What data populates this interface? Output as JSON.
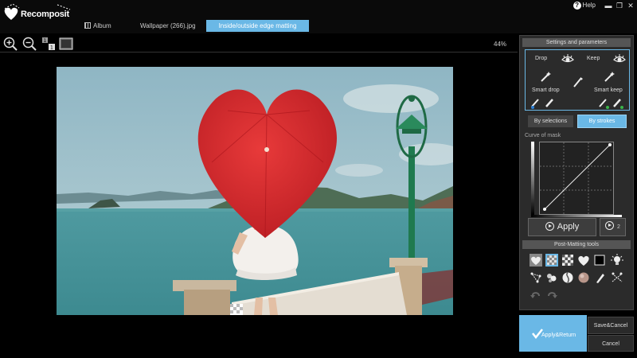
{
  "app": {
    "name": "Recomposit"
  },
  "header": {
    "help_label": "Help",
    "tabs": [
      {
        "label": "Album",
        "icon": "album-icon"
      },
      {
        "label": "Wallpaper (266).jpg"
      },
      {
        "label": "Inside/outside edge matting",
        "active": true
      }
    ]
  },
  "toolbar": {
    "zoom_percent": "44%",
    "tools": [
      "zoom-in-icon",
      "zoom-out-icon",
      "actual-size-icon",
      "fit-to-screen-icon"
    ]
  },
  "panel": {
    "title": "Settings and parameters",
    "drop_label": "Drop",
    "keep_label": "Keep",
    "smart_drop_label": "Smart drop",
    "smart_keep_label": "Smart keep",
    "mode_by_selections": "By selections",
    "mode_by_strokes": "By strokes",
    "active_mode": "By strokes",
    "curve_label": "Curve of mask",
    "apply_label": "Apply",
    "apply2_label": "2",
    "post_title": "Post-Matting tools"
  },
  "footer": {
    "apply_return": "Apply&Return",
    "save_cancel": "Save&Cancel",
    "cancel": "Cancel"
  },
  "colors": {
    "accent": "#6ab8e6",
    "umbrella": "#d8262a",
    "lamp": "#1f7a4f"
  }
}
